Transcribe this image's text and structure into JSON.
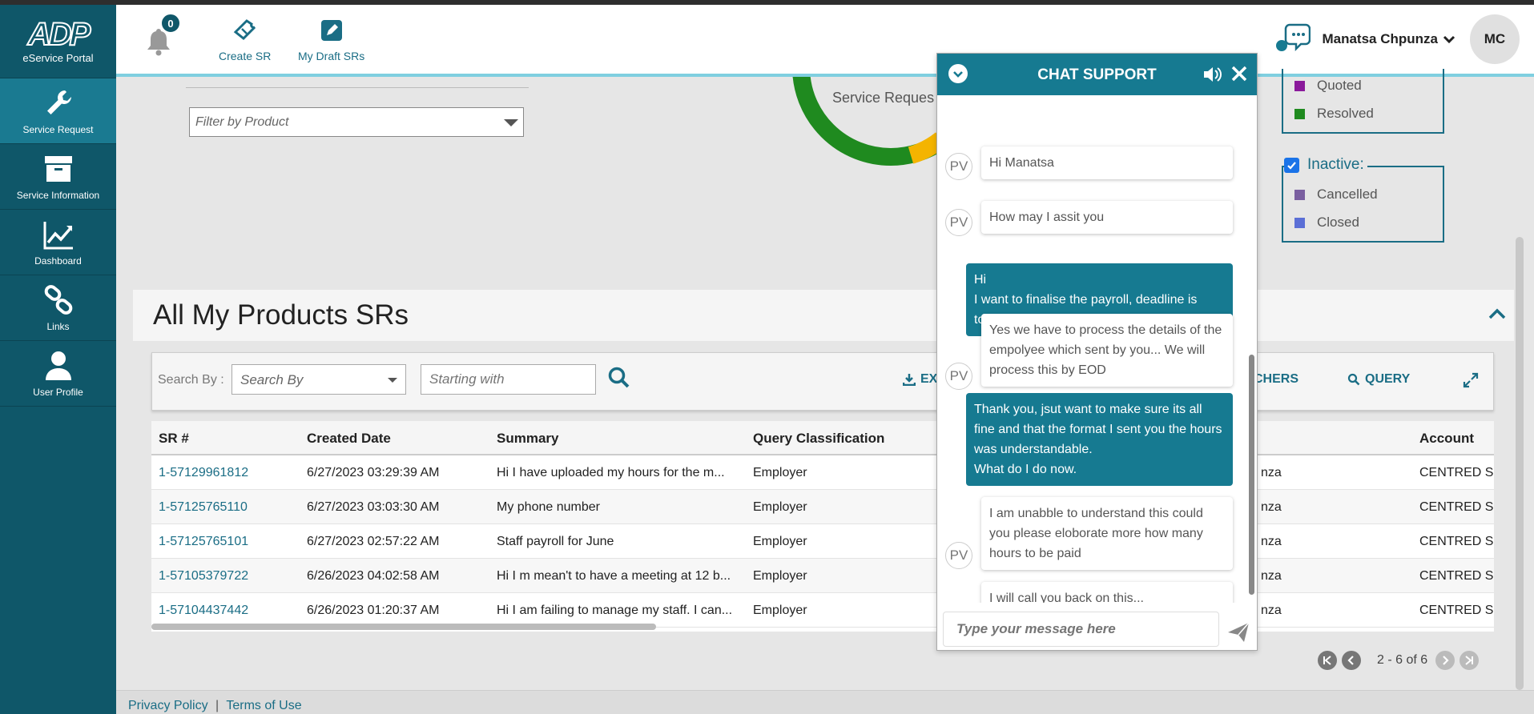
{
  "app": {
    "logo_mark": "ADP",
    "logo_subtitle": "eService Portal"
  },
  "sidebar": {
    "items": [
      {
        "label": "Service Request",
        "icon": "wrench-icon",
        "active": true
      },
      {
        "label": "Service Information",
        "icon": "archive-box-icon",
        "active": false
      },
      {
        "label": "Dashboard",
        "icon": "chart-line-icon",
        "active": false
      },
      {
        "label": "Links",
        "icon": "link-icon",
        "active": false
      },
      {
        "label": "User Profile",
        "icon": "user-icon",
        "active": false
      }
    ]
  },
  "header": {
    "notification_count": "0",
    "create_sr_label": "Create SR",
    "draft_srs_label": "My Draft SRs",
    "user_name": "Manatsa Chpunza",
    "avatar_initials": "MC"
  },
  "filters": {
    "product_placeholder": "Filter by Product"
  },
  "donut": {
    "label": "Service Reques",
    "segments": [
      {
        "name": "green",
        "color": "#1f8a1f"
      },
      {
        "name": "yellow",
        "color": "#f4b400"
      }
    ]
  },
  "legend": {
    "active_items": [
      {
        "label": "Quoted",
        "color": "#8a1a9b"
      },
      {
        "label": "Resolved",
        "color": "#1f8a1f"
      }
    ],
    "inactive_title": "Inactive:",
    "inactive_checked": true,
    "inactive_items": [
      {
        "label": "Cancelled",
        "color": "#7a5fa0"
      },
      {
        "label": "Closed",
        "color": "#5b6fd6"
      }
    ]
  },
  "sr_panel": {
    "title": "All My Products SRs",
    "search_by_label": "Search By :",
    "search_by_value": "Search By",
    "starting_with_placeholder": "Starting with",
    "export_label": "EX",
    "vouchers_label": "CHERS",
    "query_label": "QUERY",
    "columns": [
      "SR #",
      "Created Date",
      "Summary",
      "Query Classification",
      "Account"
    ],
    "rows": [
      {
        "sr": "1-57129961812",
        "date": "6/27/2023 03:29:39 AM",
        "summary": "Hi I have uploaded my hours for the m...",
        "classification": "Employer",
        "contact": "nza",
        "account": "CENTRED S"
      },
      {
        "sr": "1-57125765110",
        "date": "6/27/2023 03:03:30 AM",
        "summary": "My phone number",
        "classification": "Employer",
        "contact": "nza",
        "account": "CENTRED S"
      },
      {
        "sr": "1-57125765101",
        "date": "6/27/2023 02:57:22 AM",
        "summary": "Staff payroll for June",
        "classification": "Employer",
        "contact": "nza",
        "account": "CENTRED S"
      },
      {
        "sr": "1-57105379722",
        "date": "6/26/2023 04:02:58 AM",
        "summary": "Hi I m mean't to have a meeting at 12 b...",
        "classification": "Employer",
        "contact": "nza",
        "account": "CENTRED S"
      },
      {
        "sr": "1-57104437442",
        "date": "6/26/2023 01:20:37 AM",
        "summary": "Hi I am failing to manage my staff. I can...",
        "classification": "Employer",
        "contact": "nza",
        "account": "CENTRED S"
      }
    ],
    "pagination": "2 - 6 of 6"
  },
  "footer": {
    "privacy": "Privacy Policy",
    "separator": "|",
    "terms": "Terms of Use"
  },
  "chat": {
    "title": "CHAT SUPPORT",
    "agent_initials": "PV",
    "messages": [
      {
        "from": "agent",
        "text": "Hi Manatsa"
      },
      {
        "from": "agent",
        "text": "How may I assit you"
      },
      {
        "from": "user",
        "text": "Hi\nI want to finalise the payroll, deadline is today"
      },
      {
        "from": "agent",
        "text": "Yes we have to process the details of the empolyee which sent by you... We will process this by EOD"
      },
      {
        "from": "user",
        "text": "Thank you, jsut want to make sure its all fine and that the format I sent you the hours was understandable.\nWhat do I do now."
      },
      {
        "from": "agent",
        "text": "I am unabble to understand this could you please eloborate more how many hours to be paid"
      },
      {
        "from": "agent",
        "text": "I will call you back on this..."
      }
    ],
    "input_placeholder": "Type your message here"
  }
}
